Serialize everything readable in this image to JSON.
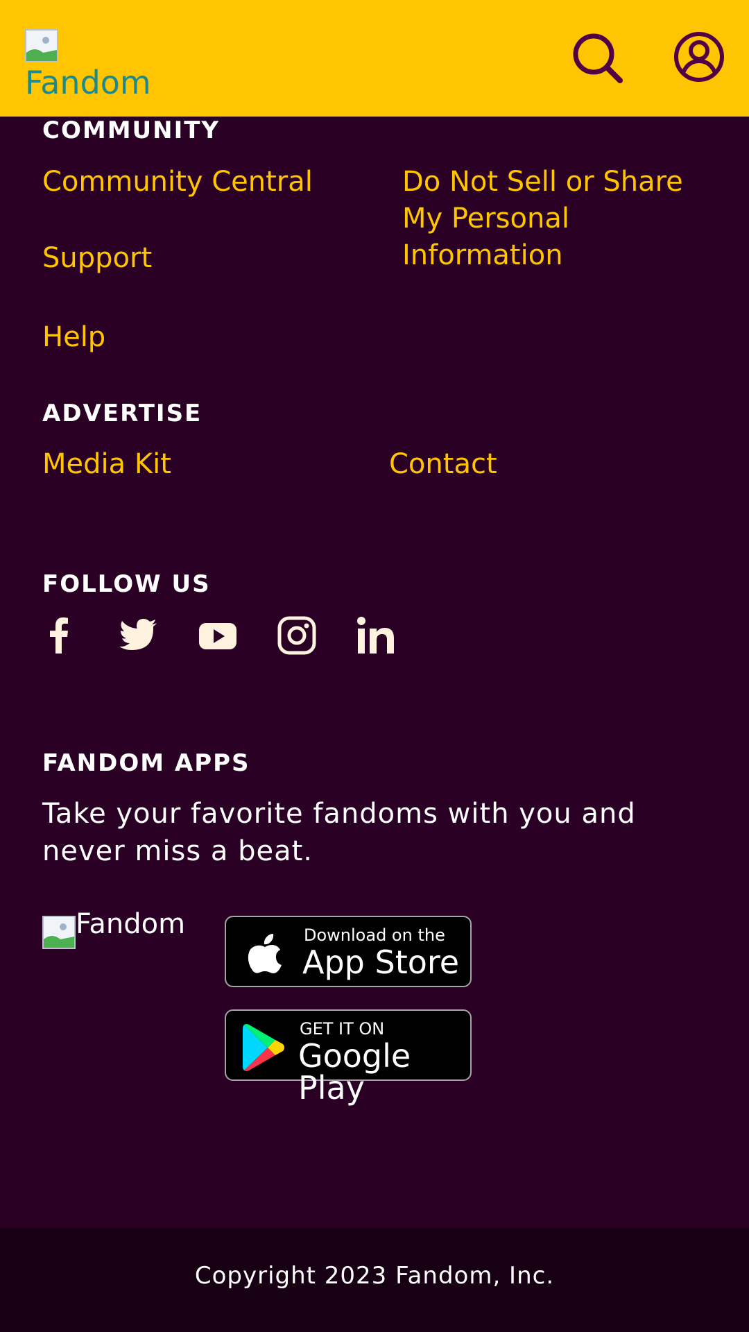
{
  "header": {
    "logo_text": "Fandom",
    "search_icon": "search-icon",
    "account_icon": "user-icon"
  },
  "community": {
    "heading": "COMMUNITY",
    "links": [
      "Community Central",
      "Support",
      "Help"
    ],
    "privacy_link_lines": [
      "Do Not Sell or Share",
      "My Personal",
      "Information"
    ]
  },
  "advertise": {
    "heading": "ADVERTISE",
    "links": [
      "Media Kit",
      "Contact"
    ]
  },
  "follow_us": {
    "heading": "FOLLOW US",
    "icons": [
      "facebook-icon",
      "twitter-icon",
      "youtube-icon",
      "instagram-icon",
      "linkedin-icon"
    ]
  },
  "fandom_apps": {
    "heading": "FANDOM APPS",
    "description": "Take your favorite fandoms with you and never miss a beat.",
    "logo_alt": "Fandom",
    "app_store": {
      "small": "Download on the",
      "big": "App Store"
    },
    "google_play": {
      "small": "GET IT ON",
      "big": "Google Play"
    }
  },
  "footer": {
    "copyright": "Copyright 2023 Fandom, Inc."
  },
  "colors": {
    "header_bg": "#ffc500",
    "page_bg": "#2a0124",
    "link": "#ffc500",
    "footer_bg": "#180014",
    "icon": "#520044"
  }
}
